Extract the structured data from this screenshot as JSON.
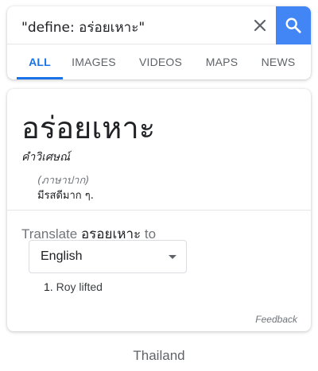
{
  "search": {
    "query": "\"define: อร่อยเหาะ\"",
    "clear_icon": "close-icon",
    "search_icon": "search-icon",
    "accent_color": "#4285f4"
  },
  "tabs": [
    {
      "label": "ALL",
      "active": true
    },
    {
      "label": "IMAGES",
      "active": false
    },
    {
      "label": "VIDEOS",
      "active": false
    },
    {
      "label": "MAPS",
      "active": false
    },
    {
      "label": "NEWS",
      "active": false
    }
  ],
  "dictionary": {
    "headword": "อร่อยเหาะ",
    "part_of_speech": "คำวิเศษณ์",
    "register": "(ภาษาปาก)",
    "definition": "มีรสดีมาก ๆ."
  },
  "translate": {
    "prefix": "Translate ",
    "word": "อรอยเหาะ",
    "suffix": " to",
    "selected_language": "English",
    "results": [
      {
        "number": "1.",
        "text": " Roy lifted"
      }
    ]
  },
  "feedback_label": "Feedback",
  "footer": {
    "location": "Thailand"
  }
}
